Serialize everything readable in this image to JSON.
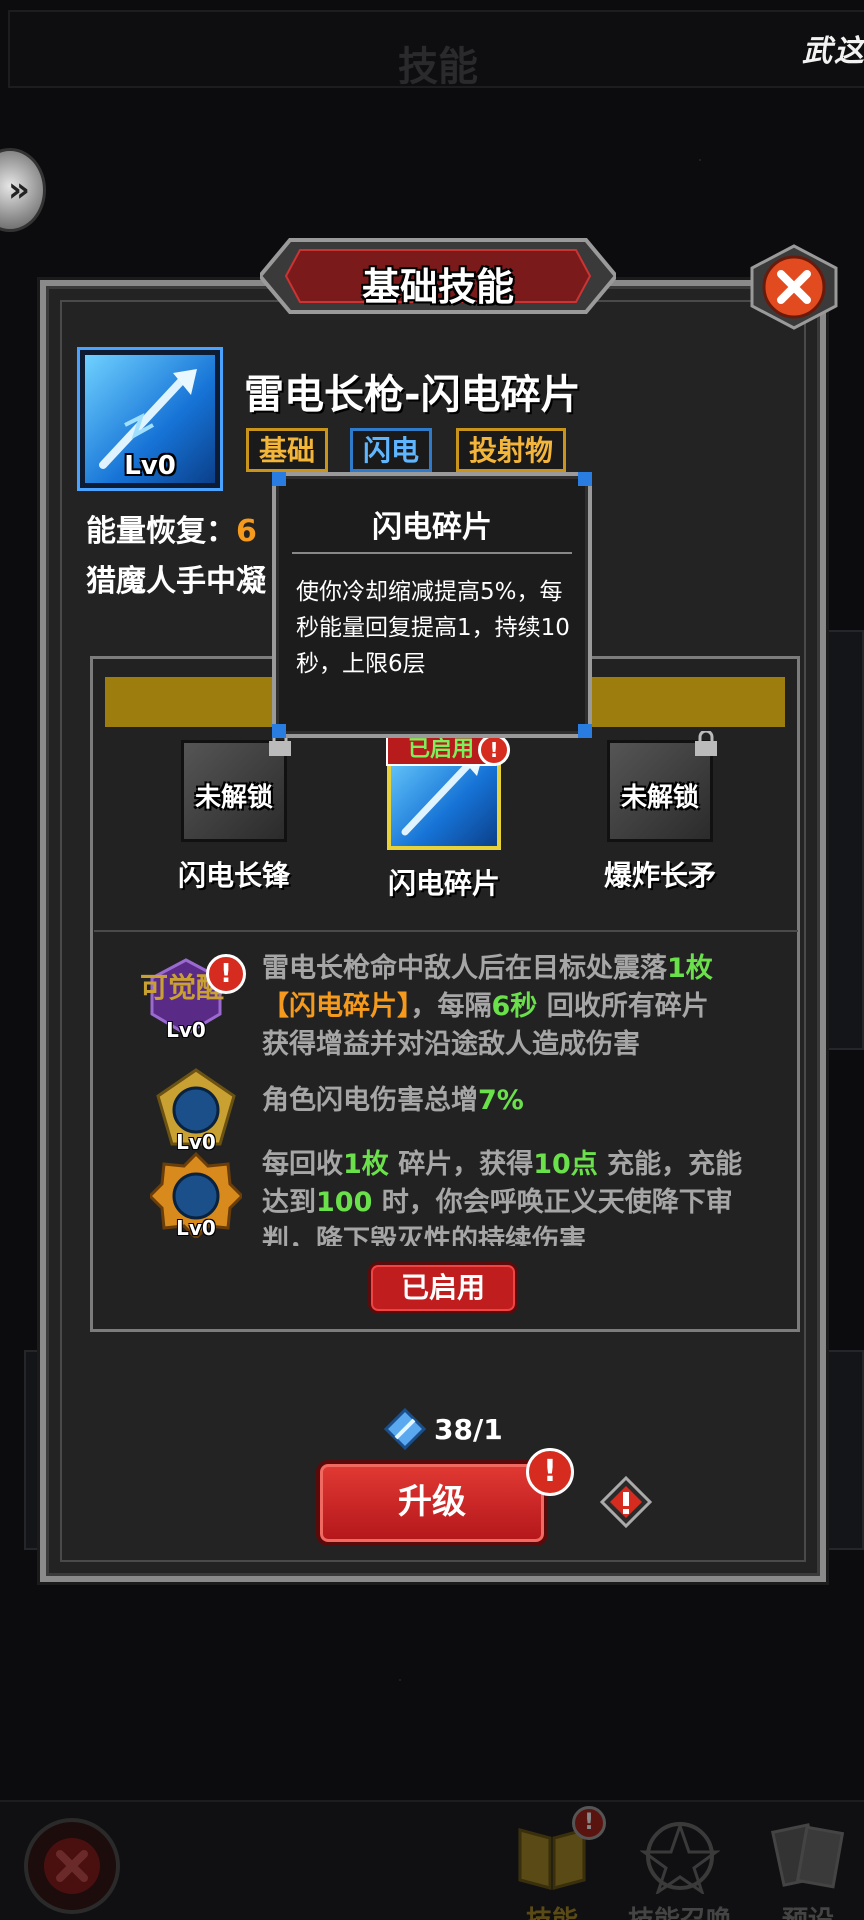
{
  "header": {
    "title": "技能",
    "top_right_label": "武这"
  },
  "dialog": {
    "banner_title": "基础技能",
    "skill": {
      "name": "雷电长枪-闪电碎片",
      "level": "Lv0",
      "tags": [
        "基础",
        "闪电",
        "投射物"
      ],
      "energy_label": "能量恢复：",
      "energy_value": "6",
      "description_visible": "猎魔人手中凝"
    },
    "tooltip": {
      "title": "闪电碎片",
      "body": "使你冷却缩减提高5%，每秒能量回复提高1，持续10秒，上限6层"
    },
    "options": [
      {
        "label": "闪电长锋",
        "status": "未解锁",
        "locked": true
      },
      {
        "label": "闪电碎片",
        "status": "已启用",
        "locked": false
      },
      {
        "label": "爆炸长矛",
        "status": "未解锁",
        "locked": true
      }
    ],
    "effects": [
      {
        "badge": "可觉醒",
        "level": "Lv0",
        "parts": [
          "雷电长枪命中敌人后在目标处震落",
          "1枚",
          "【闪电碎片】",
          "，每隔",
          "6秒",
          " 回收所有碎片",
          "获得增益并对沿途敌人造成伤害"
        ]
      },
      {
        "level": "Lv0",
        "parts": [
          "角色闪电伤害总增",
          "7%"
        ]
      },
      {
        "level": "Lv0",
        "parts": [
          "每回收",
          "1枚",
          " 碎片，获得",
          "10点",
          " 充能，充能",
          "达到",
          "100",
          " 时，你会呼唤正义天使降下审",
          "判，降下毁灭性的持续伤害"
        ]
      }
    ],
    "enabled_button": "已启用",
    "cost": "38/1",
    "upgrade_button": "升级",
    "alert_mark": "!"
  },
  "bottom_nav": [
    {
      "label": "技能",
      "icon": "book-icon",
      "active": true
    },
    {
      "label": "技能召唤",
      "icon": "pentagram-icon",
      "active": false
    },
    {
      "label": "预设",
      "icon": "cards-icon",
      "active": false
    }
  ],
  "colors": {
    "accent_red": "#c01e1e",
    "gold": "#9c7d0e",
    "highlight_green": "#6ae04a",
    "highlight_orange": "#f59a1c",
    "lightning_blue": "#1673d6"
  }
}
